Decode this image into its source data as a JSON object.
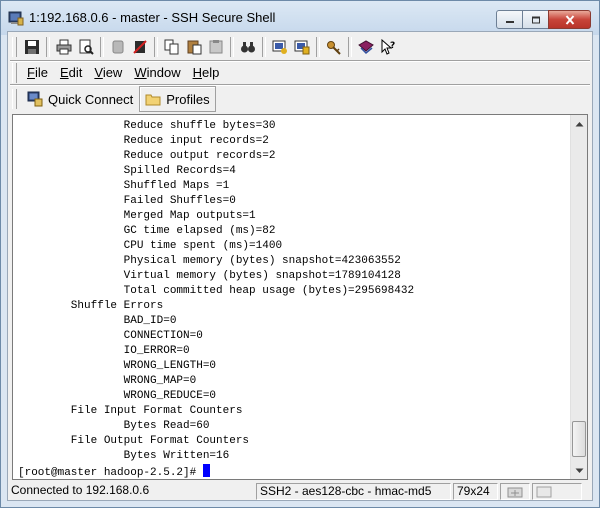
{
  "window": {
    "title": "1:192.168.0.6 - master - SSH Secure Shell",
    "icon": "ssh-terminal-icon",
    "caption_buttons": [
      "minimize-icon",
      "maximize-icon",
      "close-icon"
    ]
  },
  "toolbar": {
    "buttons": [
      {
        "name": "save-icon"
      },
      {
        "name": "print-icon"
      },
      {
        "name": "print-preview-icon"
      },
      {
        "name": "connect-icon"
      },
      {
        "name": "disconnect-icon"
      },
      {
        "name": "copy-icon"
      },
      {
        "name": "paste-icon"
      },
      {
        "name": "paste-file-icon"
      },
      {
        "name": "find-icon"
      },
      {
        "name": "settings-icon"
      },
      {
        "name": "profile-settings-icon"
      },
      {
        "name": "key-icon"
      },
      {
        "name": "help-book-icon"
      },
      {
        "name": "help-pointer-icon"
      }
    ]
  },
  "menu": {
    "items": [
      {
        "label": "File",
        "accel": "F",
        "rest": "ile"
      },
      {
        "label": "Edit",
        "accel": "E",
        "rest": "dit"
      },
      {
        "label": "View",
        "accel": "V",
        "rest": "iew"
      },
      {
        "label": "Window",
        "accel": "W",
        "rest": "indow"
      },
      {
        "label": "Help",
        "accel": "H",
        "rest": "elp"
      }
    ]
  },
  "quickbar": {
    "quick_connect": "Quick Connect",
    "profiles": "Profiles"
  },
  "terminal": {
    "lines": [
      "\t\tReduce shuffle bytes=30",
      "\t\tReduce input records=2",
      "\t\tReduce output records=2",
      "\t\tSpilled Records=4",
      "\t\tShuffled Maps =1",
      "\t\tFailed Shuffles=0",
      "\t\tMerged Map outputs=1",
      "\t\tGC time elapsed (ms)=82",
      "\t\tCPU time spent (ms)=1400",
      "\t\tPhysical memory (bytes) snapshot=423063552",
      "\t\tVirtual memory (bytes) snapshot=1789104128",
      "\t\tTotal committed heap usage (bytes)=295698432",
      "\tShuffle Errors",
      "\t\tBAD_ID=0",
      "\t\tCONNECTION=0",
      "\t\tIO_ERROR=0",
      "\t\tWRONG_LENGTH=0",
      "\t\tWRONG_MAP=0",
      "\t\tWRONG_REDUCE=0",
      "\tFile Input Format Counters ",
      "\t\tBytes Read=60",
      "\tFile Output Format Counters ",
      "\t\tBytes Written=16"
    ],
    "prompt": "[root@master hadoop-2.5.2]# ",
    "cursor_color": "#0000ff"
  },
  "status": {
    "connection": "Connected to 192.168.0.6",
    "crypto": "SSH2 - aes128-cbc - hmac-md5",
    "size": "79x24"
  }
}
